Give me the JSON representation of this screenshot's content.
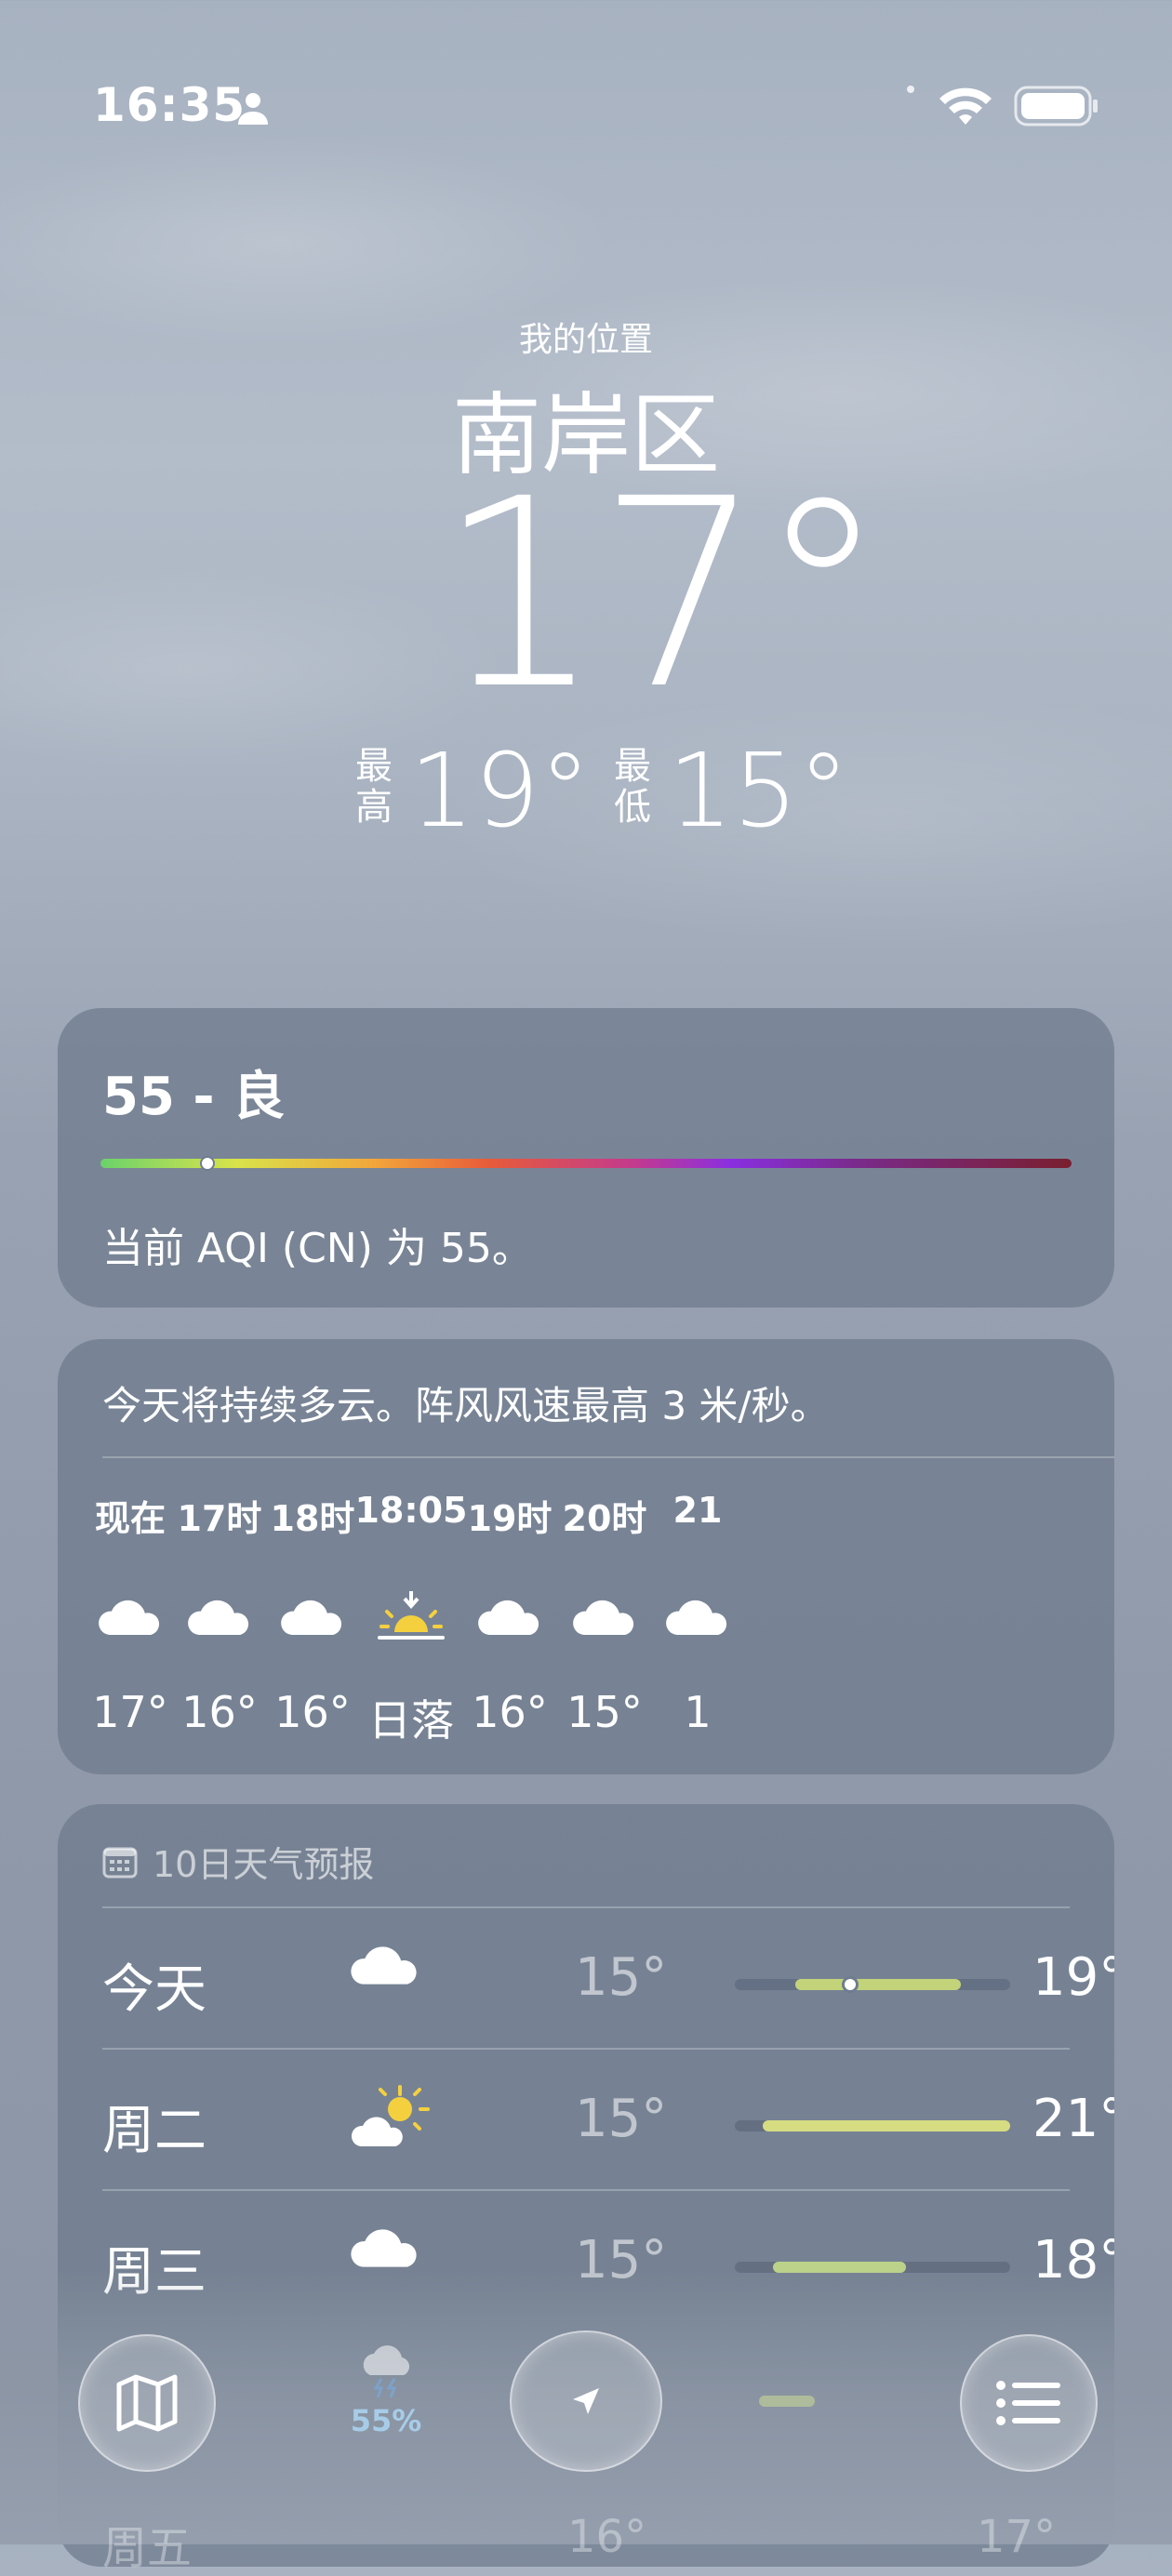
{
  "status_bar": {
    "time": "16:35"
  },
  "header": {
    "subtitle": "我的位置",
    "city": "南岸区",
    "temperature": "17°",
    "high_label": "最高",
    "high": "19°",
    "low_label": "最低",
    "low": "15°"
  },
  "aqi": {
    "title": "55 - 良",
    "description": "当前 AQI (CN) 为 55。",
    "indicator_fraction": 0.11
  },
  "hourly": {
    "summary": "今天将持续多云。阵风风速最高 3 米/秒。",
    "items": [
      {
        "label": "现在",
        "icon": "cloud-icon",
        "temp": "17°"
      },
      {
        "label": "17时",
        "icon": "cloud-icon",
        "temp": "16°"
      },
      {
        "label": "18时",
        "icon": "cloud-icon",
        "temp": "16°"
      },
      {
        "label": "18:05",
        "icon": "sunset-icon",
        "temp": "日落"
      },
      {
        "label": "19时",
        "icon": "cloud-icon",
        "temp": "16°"
      },
      {
        "label": "20时",
        "icon": "cloud-icon",
        "temp": "15°"
      },
      {
        "label": "21",
        "icon": "cloud-icon",
        "temp": "1"
      }
    ]
  },
  "daily": {
    "header": "10日天气预报",
    "days": [
      {
        "name": "今天",
        "icon": "cloud-icon",
        "low": "15°",
        "high": "19°",
        "range_start": 0.22,
        "range_end": 0.82,
        "current": 0.42,
        "fill": "#c2d37a"
      },
      {
        "name": "周二",
        "icon": "partly-sunny-icon",
        "low": "15°",
        "high": "21°",
        "range_start": 0.1,
        "range_end": 1.0,
        "current": null,
        "fill": "#d6dc82"
      },
      {
        "name": "周三",
        "icon": "cloud-icon",
        "low": "15°",
        "high": "18°",
        "range_start": 0.14,
        "range_end": 0.62,
        "current": null,
        "fill": "#bcd28a"
      }
    ]
  },
  "toolbar": {
    "partial_rain_chance": "55%"
  },
  "partial_next_day": {
    "name": "周五",
    "low": "16°",
    "high": "17°"
  }
}
